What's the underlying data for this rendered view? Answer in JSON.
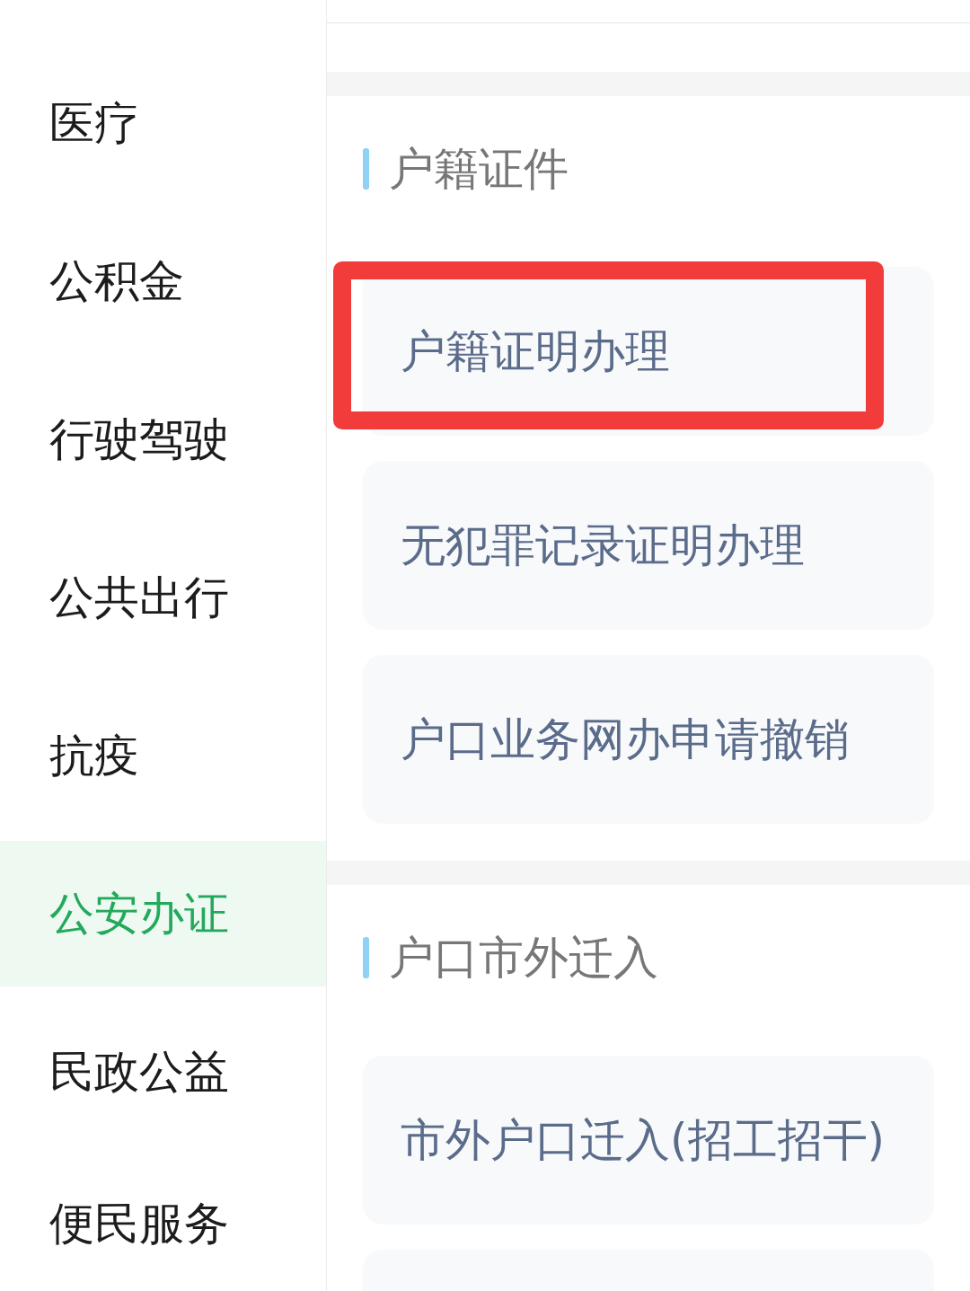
{
  "sidebar": {
    "items": [
      {
        "label": "医疗",
        "selected": false
      },
      {
        "label": "公积金",
        "selected": false
      },
      {
        "label": "行驶驾驶",
        "selected": false
      },
      {
        "label": "公共出行",
        "selected": false
      },
      {
        "label": "抗疫",
        "selected": false
      },
      {
        "label": "公安办证",
        "selected": true
      },
      {
        "label": "民政公益",
        "selected": false
      },
      {
        "label": "便民服务",
        "selected": false
      }
    ]
  },
  "sections": [
    {
      "title": "户籍证件",
      "items": [
        {
          "label": "户籍证明办理",
          "highlighted": true
        },
        {
          "label": "无犯罪记录证明办理",
          "highlighted": false
        },
        {
          "label": "户口业务网办申请撤销",
          "highlighted": false
        }
      ]
    },
    {
      "title": "户口市外迁入",
      "items": [
        {
          "label": "市外户口迁入(招工招干)",
          "highlighted": false
        },
        {
          "highlighted": false
        }
      ]
    }
  ]
}
